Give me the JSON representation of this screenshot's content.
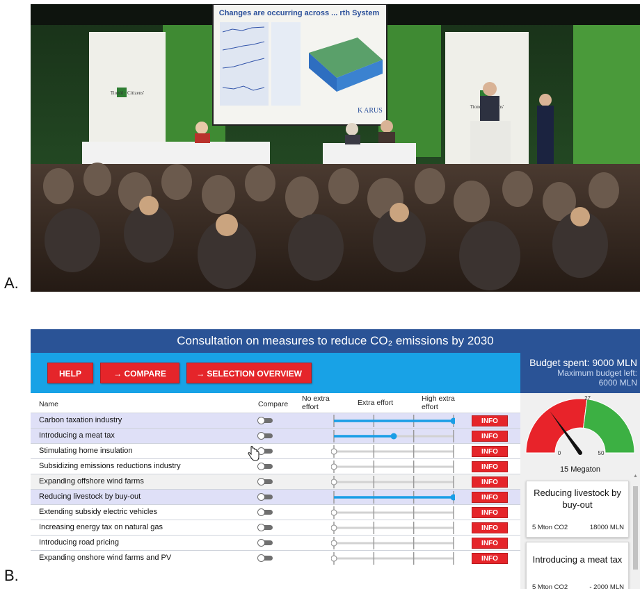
{
  "panel_labels": {
    "a": "A.",
    "b": "B."
  },
  "photo": {
    "screen_title": "Changes are occurring across ... rth System",
    "screen_footer": "K ARUS",
    "banner_left": "an Tionól Saoránach ■■ the Citizens' Assembly",
    "banner_right": "an Tionól Saoránach ■■ the Citizens' Assembly"
  },
  "app": {
    "title": "Consultation on measures to reduce CO₂ emissions by 2030",
    "buttons": {
      "help": "HELP",
      "compare": "→ COMPARE",
      "overview": "→ SELECTION OVERVIEW"
    },
    "budget": {
      "spent": "Budget spent: 9000 MLN",
      "left": "Maximum budget left: 6000 MLN"
    },
    "table": {
      "col_name": "Name",
      "col_compare": "Compare",
      "effort_levels": [
        "No extra effort",
        "Extra effort",
        "High extra effort"
      ]
    },
    "info_label": "INFO",
    "measures": [
      {
        "name": "Carbon taxation industry",
        "effort": 1.0,
        "selected": true
      },
      {
        "name": "Introducing a meat tax",
        "effort": 0.5,
        "selected": true
      },
      {
        "name": "Stimulating home insulation",
        "effort": 0,
        "selected": false
      },
      {
        "name": "Subsidizing emissions reductions industry",
        "effort": 0,
        "selected": false
      },
      {
        "name": "Expanding offshore wind farms",
        "effort": 0,
        "selected": false,
        "hover": true
      },
      {
        "name": "Reducing livestock by buy-out",
        "effort": 1.0,
        "selected": true
      },
      {
        "name": "Extending subsidy electric vehicles",
        "effort": 0,
        "selected": false
      },
      {
        "name": "Increasing energy tax on natural gas",
        "effort": 0,
        "selected": false
      },
      {
        "name": "Introducing road pricing",
        "effort": 0,
        "selected": false
      },
      {
        "name": "Expanding onshore wind farms and PV",
        "effort": 0,
        "selected": false
      }
    ],
    "gauge": {
      "min_label": "0",
      "target_label": "27",
      "max_label": "50",
      "value": 15,
      "min": 0,
      "max": 50,
      "target": 27,
      "caption": "15 Megaton",
      "colors": {
        "below": "#e8232a",
        "above": "#3cb043"
      }
    },
    "cards": [
      {
        "title": "Reducing livestock by buy-out",
        "co2": "5 Mton CO2",
        "cost": "18000 MLN"
      },
      {
        "title": "Introducing a meat tax",
        "co2": "5 Mton CO2",
        "cost": "- 2000 MLN"
      }
    ],
    "colors": {
      "header": "#2a5396",
      "toolbar": "#18a2e6",
      "button": "#e5252a",
      "slider": "#1a9ee6"
    }
  }
}
